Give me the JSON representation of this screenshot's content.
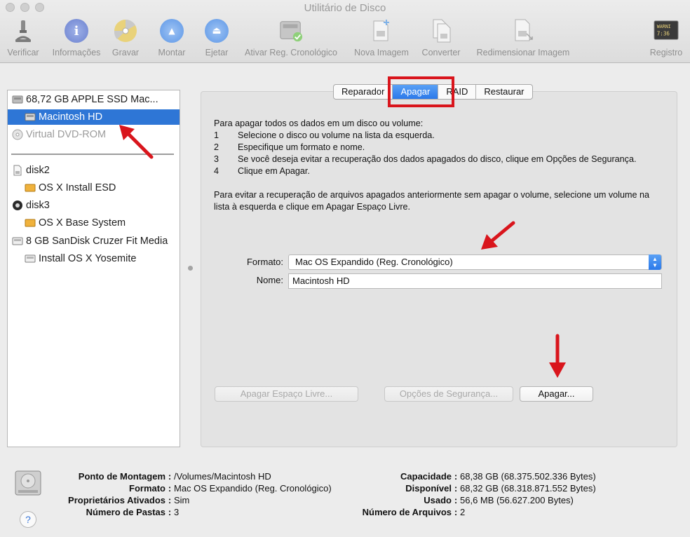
{
  "window": {
    "title": "Utilitário de Disco"
  },
  "toolbar": {
    "items": [
      {
        "label": "Verificar",
        "icon": "microscope-icon"
      },
      {
        "label": "Informações",
        "icon": "info-icon"
      },
      {
        "label": "Gravar",
        "icon": "burn-disc-icon"
      },
      {
        "label": "Montar",
        "icon": "mount-icon"
      },
      {
        "label": "Ejetar",
        "icon": "eject-icon"
      },
      {
        "label": "Ativar Reg. Cronológico",
        "icon": "journal-disk-icon"
      },
      {
        "label": "Nova Imagem",
        "icon": "new-image-icon"
      },
      {
        "label": "Converter",
        "icon": "convert-icon"
      },
      {
        "label": "Redimensionar Imagem",
        "icon": "resize-image-icon"
      },
      {
        "label": "Registro",
        "icon": "log-console-icon"
      }
    ],
    "log_icon_text": "WARNI\n7:36"
  },
  "sidebar": {
    "items": [
      {
        "label": "68,72 GB APPLE SSD Mac...",
        "icon": "internal-drive-icon"
      },
      {
        "label": "Macintosh HD",
        "icon": "volume-icon"
      },
      {
        "label": "Virtual DVD-ROM",
        "icon": "dvd-icon"
      },
      {
        "label": "disk2",
        "icon": "disk-image-icon"
      },
      {
        "label": "OS X Install ESD",
        "icon": "volume-orange-icon"
      },
      {
        "label": "disk3",
        "icon": "disk-image-icon"
      },
      {
        "label": "OS X Base System",
        "icon": "volume-orange-icon"
      },
      {
        "label": "8 GB SanDisk Cruzer Fit Media",
        "icon": "usb-drive-icon"
      },
      {
        "label": "Install OS X Yosemite",
        "icon": "volume-icon"
      }
    ]
  },
  "tabs": [
    {
      "label": "Reparador"
    },
    {
      "label": "Apagar"
    },
    {
      "label": "RAID"
    },
    {
      "label": "Restaurar"
    }
  ],
  "instructions": {
    "intro": "Para apagar todos os dados em um disco ou volume:",
    "steps": [
      {
        "num": "1",
        "text": "Selecione o disco ou volume na lista da esquerda."
      },
      {
        "num": "2",
        "text": "Especifique um formato e nome."
      },
      {
        "num": "3",
        "text": "Se você deseja evitar a recuperação dos dados apagados do disco, clique em Opções de Segurança."
      },
      {
        "num": "4",
        "text": "Clique em Apagar."
      }
    ],
    "paragraph2": "Para evitar a recuperação de arquivos apagados anteriormente sem apagar o volume, selecione um volume na lista à esquerda e clique em Apagar Espaço Livre."
  },
  "form": {
    "format_label": "Formato:",
    "format_value": "Mac OS Expandido (Reg. Cronológico)",
    "name_label": "Nome:",
    "name_value": "Macintosh HD"
  },
  "buttons": {
    "erase_free_space": "Apagar Espaço Livre...",
    "security_options": "Opções de Segurança...",
    "erase": "Apagar..."
  },
  "info": {
    "left": [
      {
        "key": "Ponto de Montagem",
        "value": "/Volumes/Macintosh HD"
      },
      {
        "key": "Formato",
        "value": "Mac OS Expandido (Reg. Cronológico)"
      },
      {
        "key": "Proprietários Ativados",
        "value": "Sim"
      },
      {
        "key": "Número de Pastas",
        "value": "3"
      }
    ],
    "right": [
      {
        "key": "Capacidade",
        "value": "68,38 GB (68.375.502.336 Bytes)"
      },
      {
        "key": "Disponível",
        "value": "68,32 GB (68.318.871.552 Bytes)"
      },
      {
        "key": "Usado",
        "value": "56,6 MB (56.627.200 Bytes)"
      },
      {
        "key": "Número de Arquivos",
        "value": "2"
      }
    ],
    "separator": ":",
    "help": "?"
  },
  "colors": {
    "selection": "#2e76d6",
    "annotation_red": "#d9151c",
    "tab_active": "#2b79ea"
  }
}
